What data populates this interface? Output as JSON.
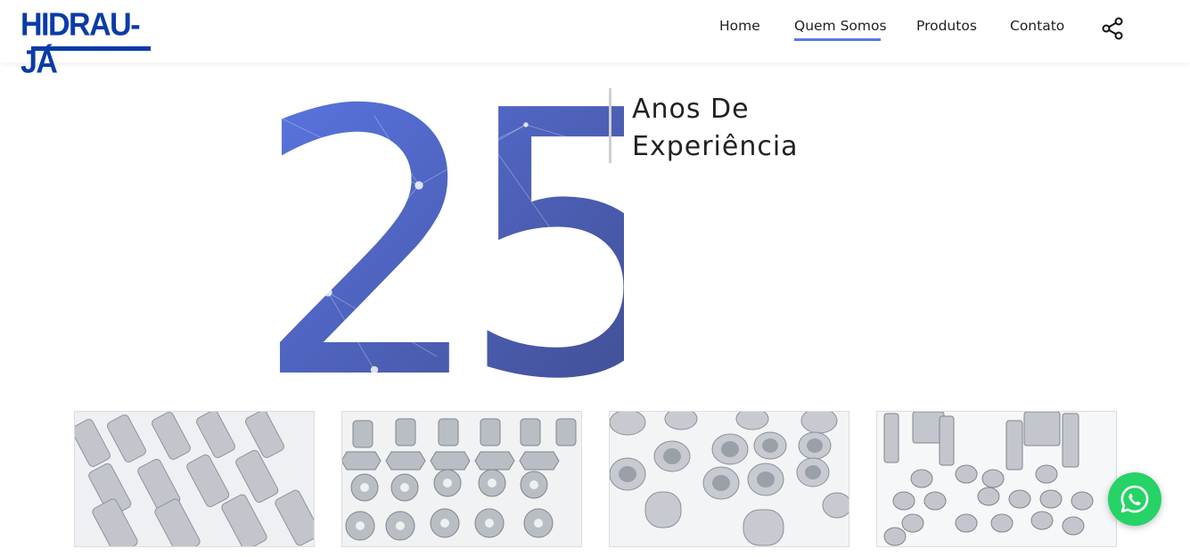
{
  "brand": {
    "logo_text": "HIDRAU-JÁ",
    "color": "#0a3ba8"
  },
  "nav": {
    "items": [
      {
        "label": "Home",
        "active": false
      },
      {
        "label": "Quem Somos",
        "active": true
      },
      {
        "label": "Produtos",
        "active": false
      },
      {
        "label": "Contato",
        "active": false
      }
    ],
    "share_icon": "share-icon",
    "active_color": "#5b78e8"
  },
  "hero": {
    "number": "25",
    "line1": "Anos De",
    "line2": "Experiência",
    "gradient_start": "#5b78e8",
    "gradient_end": "#3f4a8a"
  },
  "gallery": [
    {
      "name": "hydraulic-fittings-hex-photo"
    },
    {
      "name": "hydraulic-flanges-photo"
    },
    {
      "name": "steel-bushings-photo"
    },
    {
      "name": "hose-fittings-photo"
    }
  ],
  "whatsapp": {
    "icon": "whatsapp-icon",
    "color": "#25d366"
  }
}
